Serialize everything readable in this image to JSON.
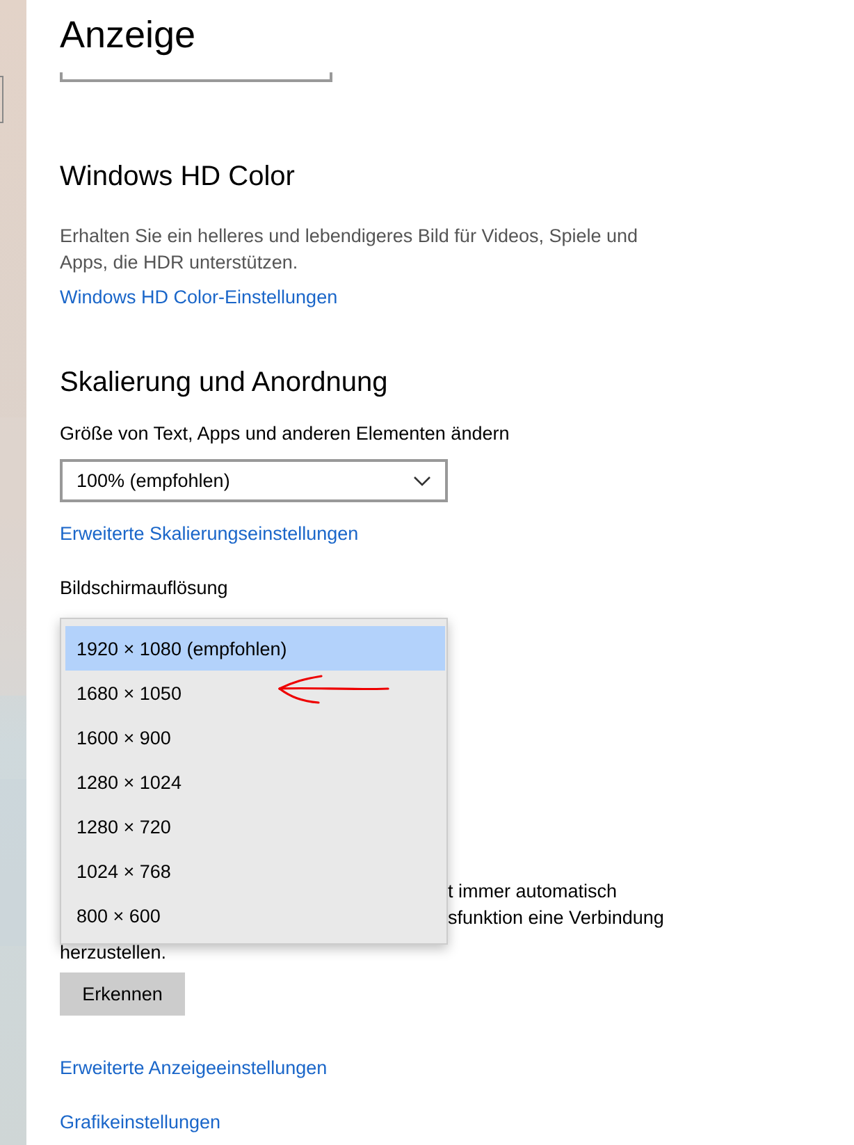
{
  "page": {
    "title": "Anzeige"
  },
  "hd_color": {
    "heading": "Windows HD Color",
    "description": "Erhalten Sie ein helleres und lebendigeres Bild für Videos, Spiele und Apps, die HDR unterstützen.",
    "link": "Windows HD Color-Einstellungen"
  },
  "scaling": {
    "heading": "Skalierung und Anordnung",
    "size_label": "Größe von Text, Apps und anderen Elementen ändern",
    "size_value": "100% (empfohlen)",
    "link": "Erweiterte Skalierungseinstellungen",
    "resolution_label": "Bildschirmauflösung"
  },
  "resolution_options": [
    {
      "label": "1920 × 1080 (empfohlen)",
      "selected": true
    },
    {
      "label": "1680 × 1050",
      "selected": false
    },
    {
      "label": "1600 × 900",
      "selected": false
    },
    {
      "label": "1280 × 1024",
      "selected": false
    },
    {
      "label": "1280 × 720",
      "selected": false
    },
    {
      "label": "1024 × 768",
      "selected": false
    },
    {
      "label": "800 × 600",
      "selected": false
    }
  ],
  "covered_text": {
    "line_1": "t immer automatisch",
    "line_2": "sfunktion eine Verbindung",
    "line_3": "herzustellen."
  },
  "detect_button": "Erkennen",
  "links": [
    "Erweiterte Anzeigeeinstellungen",
    "Grafikeinstellungen"
  ]
}
